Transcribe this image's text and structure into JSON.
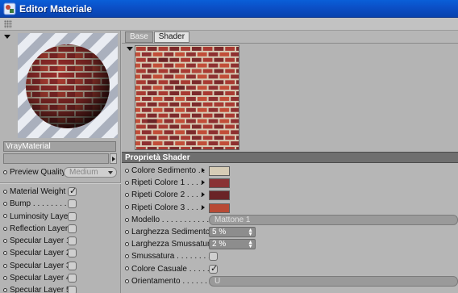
{
  "window": {
    "title": "Editor Materiale",
    "icons": [
      "app-icon",
      "back-arrow-icon",
      "forward-arrow-icon",
      "pin-icon"
    ]
  },
  "left": {
    "material_name": "VrayMaterial",
    "material_field_value": "",
    "preview_quality": {
      "label": "Preview Quality",
      "value": "Medium"
    },
    "channels": [
      {
        "label": "Material Weight",
        "checked": true
      },
      {
        "label": "Bump . . . . . . . . .",
        "checked": false
      },
      {
        "label": "Luminosity Layer",
        "checked": false
      },
      {
        "label": "Reflection Layer",
        "checked": false
      },
      {
        "label": "Specular Layer 1",
        "checked": false
      },
      {
        "label": "Specular Layer 2",
        "checked": false
      },
      {
        "label": "Specular Layer 3",
        "checked": false
      },
      {
        "label": "Specular Layer 4",
        "checked": false
      },
      {
        "label": "Specular Layer 5",
        "checked": false
      }
    ]
  },
  "right": {
    "tabs": [
      {
        "label": "Base",
        "active": false
      },
      {
        "label": "Shader",
        "active": true
      }
    ],
    "section_title": "Proprietà Shader",
    "props": {
      "colore_sedimento": {
        "label": "Colore Sedimento . .",
        "color": "#d6ccb6"
      },
      "ripeti_colore_1": {
        "label": "Ripeti Colore 1 . . . .",
        "color": "#8a3235"
      },
      "ripeti_colore_2": {
        "label": "Ripeti Colore 2 . . . .",
        "color": "#6a2427"
      },
      "ripeti_colore_3": {
        "label": "Ripeti Colore 3 . . . .",
        "color": "#b84a35"
      },
      "modello": {
        "label": "Modello . . . . . . . . . . . .",
        "value": "Mattone 1"
      },
      "larghezza_sedimento": {
        "label": "Larghezza Sedimento",
        "value": "5 %"
      },
      "larghezza_smussatura": {
        "label": "Larghezza Smussatura",
        "value": "2 %"
      },
      "smussatura": {
        "label": "Smussatura . . . . . . . .",
        "checked": false
      },
      "colore_casuale": {
        "label": "Colore Casuale . . . . .",
        "checked": true
      },
      "orientamento": {
        "label": "Orientamento . . . . . .",
        "value": "U"
      }
    }
  },
  "colors": {
    "titlebar": "#0b4fc6",
    "brick_dark": "#7a2a2a",
    "brick_light": "#c05a45",
    "mortar": "#d9cdb8"
  }
}
